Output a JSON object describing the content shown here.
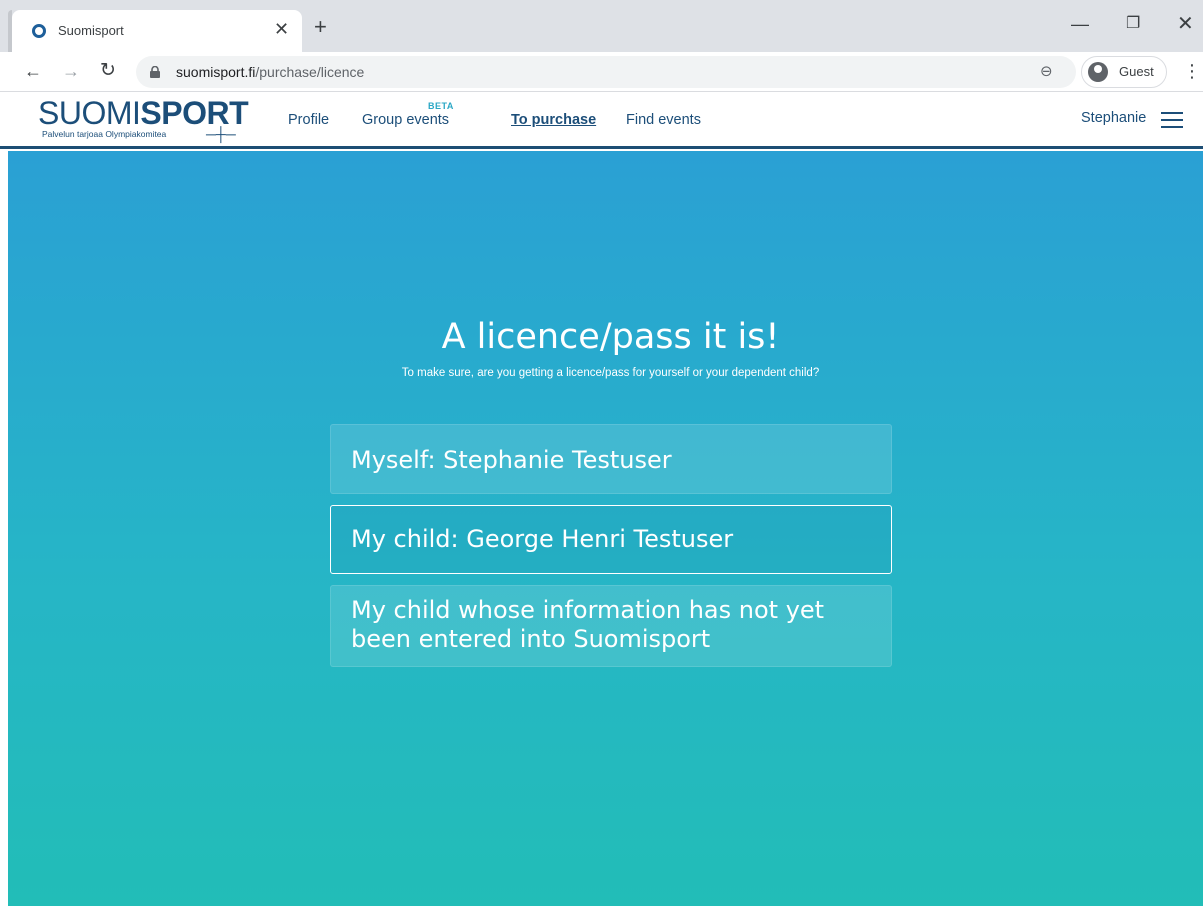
{
  "browser": {
    "tab_title": "Suomisport",
    "url_host": "suomisport.fi",
    "url_path": "/purchase/licence",
    "profile_label": "Guest"
  },
  "site": {
    "logo": {
      "word_light": "SUOMI",
      "word_bold": "SPORT",
      "tagline": "Palvelun tarjoaa Olympiakomitea"
    },
    "nav": {
      "profile": "Profile",
      "group_events": "Group events",
      "beta_badge": "BETA",
      "to_purchase": "To purchase",
      "find_events": "Find events"
    },
    "user_name": "Stephanie"
  },
  "main": {
    "title": "A licence/pass it is!",
    "subtitle": "To make sure, are you getting a licence/pass for yourself or your dependent child?",
    "options": [
      {
        "label": "Myself: Stephanie Testuser"
      },
      {
        "label": "My child: George Henri Testuser"
      },
      {
        "label_line1": "My child whose information has not yet",
        "label_line2": "been entered into Suomisport"
      }
    ]
  },
  "colors": {
    "brand_navy": "#1c4e79",
    "accent_teal": "#2aa7c5",
    "gradient_top": "#2aa0d4",
    "gradient_bottom": "#22bdb7"
  }
}
